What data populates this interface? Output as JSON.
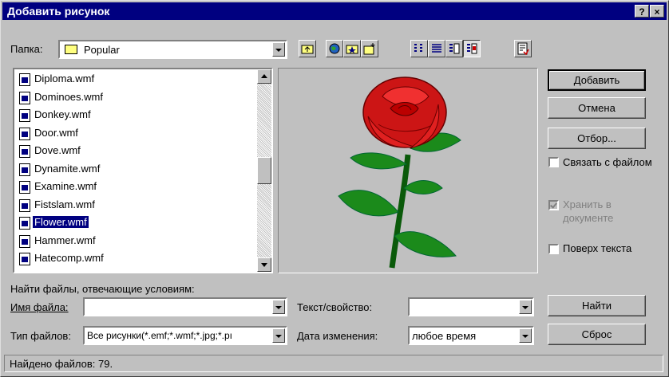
{
  "window": {
    "title": "Добавить рисунок",
    "help_glyph": "?",
    "close_glyph": "×"
  },
  "folder": {
    "label": "Папка:",
    "value": "Popular"
  },
  "files": [
    {
      "name": "Diploma.wmf",
      "selected": false
    },
    {
      "name": "Dominoes.wmf",
      "selected": false
    },
    {
      "name": "Donkey.wmf",
      "selected": false
    },
    {
      "name": "Door.wmf",
      "selected": false
    },
    {
      "name": "Dove.wmf",
      "selected": false
    },
    {
      "name": "Dynamite.wmf",
      "selected": false
    },
    {
      "name": "Examine.wmf",
      "selected": false
    },
    {
      "name": "Fistslam.wmf",
      "selected": false
    },
    {
      "name": "Flower.wmf",
      "selected": true
    },
    {
      "name": "Hammer.wmf",
      "selected": false
    },
    {
      "name": "Hatecomp.wmf",
      "selected": false
    }
  ],
  "buttons": {
    "add": "Добавить",
    "cancel": "Отмена",
    "filter": "Отбор...",
    "find": "Найти",
    "reset": "Сброс"
  },
  "options": {
    "link_to_file": {
      "label": "Связать с файлом",
      "checked": false,
      "enabled": true
    },
    "save_in_document": {
      "label_line1": "Хранить в",
      "label_line2": "документе",
      "checked": true,
      "enabled": false
    },
    "over_text": {
      "label": "Поверх текста",
      "checked": false,
      "enabled": true
    }
  },
  "search": {
    "heading": "Найти файлы, отвечающие условиям:",
    "filename_label": "Имя файла:",
    "filename_value": "",
    "filetype_label": "Тип файлов:",
    "filetype_value": "Все рисунки(*.emf;*.wmf;*.jpg;*.pı",
    "text_label": "Текст/свойство:",
    "text_value": "",
    "date_label": "Дата изменения:",
    "date_value": "любое время"
  },
  "status": "Найдено файлов: 79.",
  "icons": [
    "up-folder-icon",
    "internet-icon",
    "favorites-icon",
    "new-folder-icon",
    "list-view-icon",
    "details-view-icon",
    "properties-view-icon",
    "preview-view-icon",
    "commands-icon"
  ]
}
